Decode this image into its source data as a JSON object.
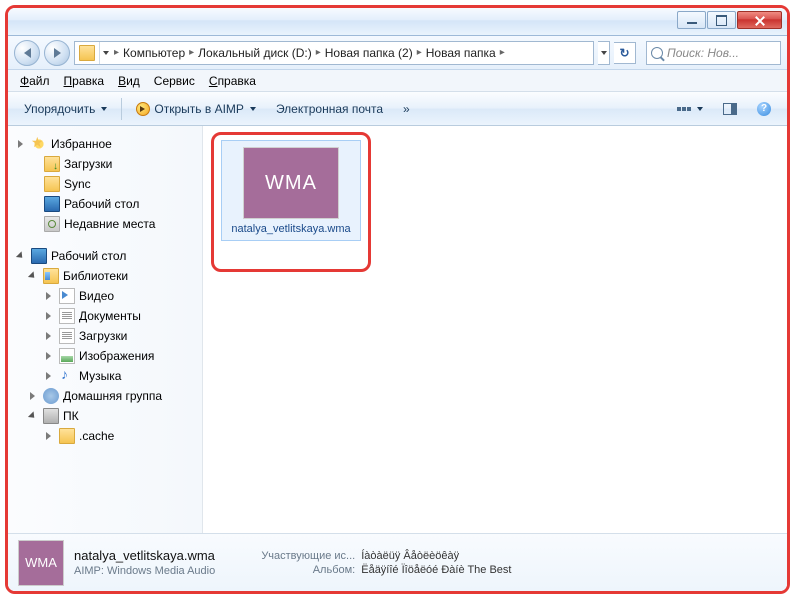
{
  "titlebar": {
    "minimize": "min",
    "maximize": "max",
    "close": "close"
  },
  "nav": {
    "breadcrumb": [
      "Компьютер",
      "Локальный диск (D:)",
      "Новая папка (2)",
      "Новая папка"
    ],
    "search_placeholder": "Поиск: Нов..."
  },
  "menu": {
    "file": "Файл",
    "edit": "Правка",
    "view": "Вид",
    "tools": "Сервис",
    "help": "Справка"
  },
  "toolbar": {
    "organize": "Упорядочить",
    "open_aimp": "Открыть в AIMP",
    "email": "Электронная почта",
    "more": "»"
  },
  "sidebar": {
    "favorites": "Избранное",
    "downloads": "Загрузки",
    "sync": "Sync",
    "desktop": "Рабочий стол",
    "recent": "Недавние места",
    "desktop2": "Рабочий стол",
    "libraries": "Библиотеки",
    "video": "Видео",
    "documents": "Документы",
    "downloads2": "Загрузки",
    "pictures": "Изображения",
    "music": "Музыка",
    "homegroup": "Домашняя группа",
    "pc": "ПК",
    "cache": ".cache"
  },
  "file": {
    "thumb_label": "WMA",
    "name": "natalya_vetlitskaya.wma"
  },
  "details": {
    "thumb": "WMA",
    "title": "natalya_vetlitskaya.wma",
    "subtitle": "AIMP: Windows Media Audio",
    "artists_label": "Участвующие ис...",
    "artists_value": "Íàòàëüÿ Âåòëèöêàÿ",
    "album_label": "Альбом:",
    "album_value": "Ëåäÿíîé Ïîöåëóé Ðàíè The Best"
  }
}
